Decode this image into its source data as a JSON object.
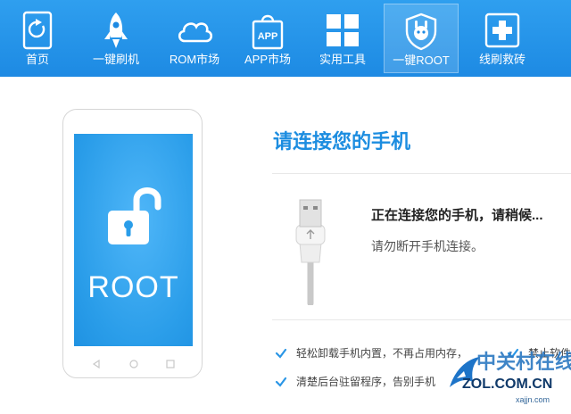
{
  "nav": {
    "items": [
      {
        "label": "首页",
        "icon": "home-icon"
      },
      {
        "label": "一键刷机",
        "icon": "rocket-icon"
      },
      {
        "label": "ROM市场",
        "icon": "cloud-icon"
      },
      {
        "label": "APP市场",
        "icon": "app-bag-icon",
        "icon_text": "APP"
      },
      {
        "label": "实用工具",
        "icon": "grid-icon"
      },
      {
        "label": "一键ROOT",
        "icon": "root-shield-icon",
        "active": true
      },
      {
        "label": "线刷救砖",
        "icon": "first-aid-icon"
      }
    ]
  },
  "phone": {
    "screen_text": "ROOT"
  },
  "connect": {
    "title": "请连接您的手机",
    "status": "正在连接您的手机，请稍候...",
    "hint": "请勿断开手机连接。"
  },
  "features": [
    "轻松卸载手机内置，不再占用内存，",
    "禁止软件",
    "清楚后台驻留程序，告别手机"
  ],
  "watermark": {
    "brand_text": "中关村在线",
    "domain": "ZOL.COM.CN",
    "url": "xajjn.com"
  },
  "colors": {
    "toolbar": "#1d8ae3",
    "accent": "#1c8de0",
    "phone_screen": "#2a9de9"
  }
}
